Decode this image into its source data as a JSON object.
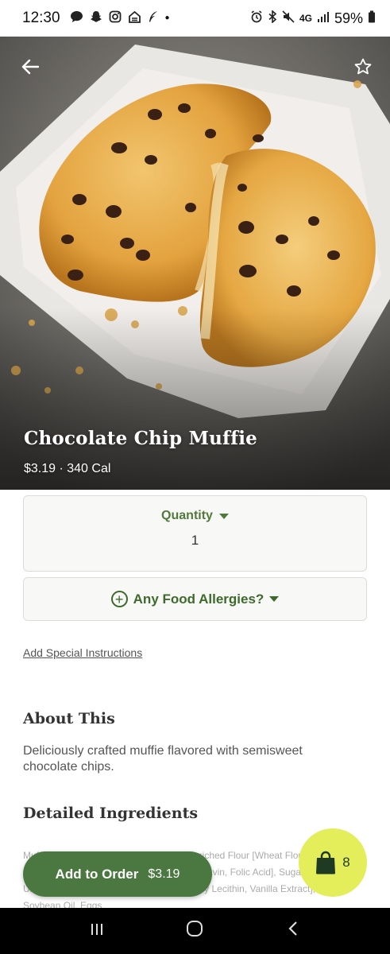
{
  "status_bar": {
    "time": "12:30",
    "left_icons": [
      "message-icon",
      "snapchat-icon",
      "instagram-icon",
      "home-icon",
      "feather-icon",
      "dot-icon"
    ],
    "network": "4G",
    "battery": "59%"
  },
  "product": {
    "name": "Chocolate Chip Muffie",
    "price_cal": "$3.19 · 340 Cal"
  },
  "quantity": {
    "label": "Quantity",
    "value": "1"
  },
  "allergies": {
    "label": "Any Food Allergies?"
  },
  "special_instructions": "Add Special Instructions",
  "about": {
    "title": "About This",
    "text": "Deliciously crafted muffie flavored with semisweet chocolate chips."
  },
  "ingredients": {
    "title": "Detailed Ingredients",
    "text": "Muffie: Chocolate Chip (Muffie Dough (Enriched Flour [Wheat Flour, Niacin, Reduced Iron, Thiamine Mononitrate, Riboflavin, Folic Acid], Sugar, Unsweetened Chocolate, Cocoa Butter, Soy Lecithin, Vanilla Extract], Water, Soybean Oil, Eggs,"
  },
  "add_to_order": {
    "label": "Add to Order",
    "price": "$3.19"
  },
  "bag": {
    "count": "8"
  },
  "colors": {
    "brand_green": "#4b7840",
    "accent_yellow": "#e4ed5a",
    "quantity_green": "#507a3c"
  }
}
